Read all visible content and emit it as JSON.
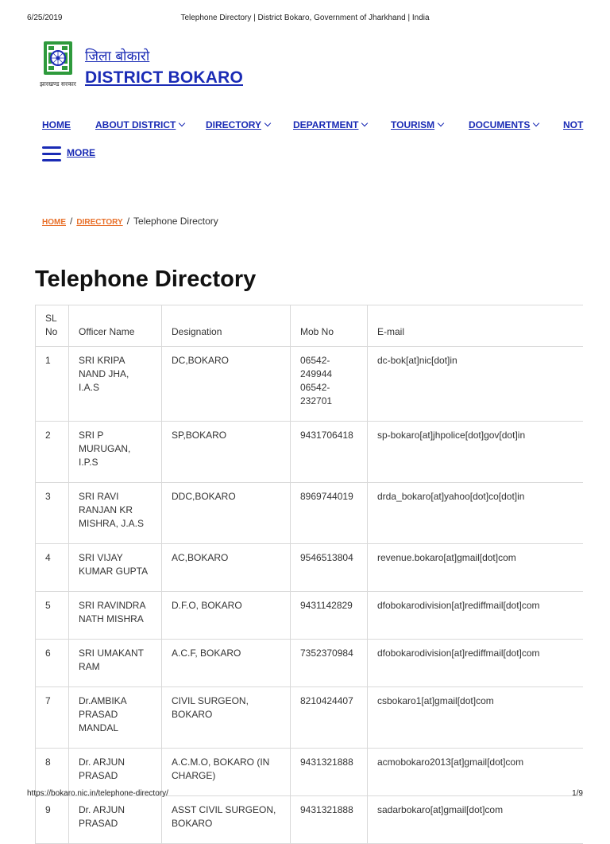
{
  "print_header": {
    "date": "6/25/2019",
    "title": "Telephone Directory | District Bokaro, Government of Jharkhand | India"
  },
  "print_footer": {
    "url": "https://bokaro.nic.in/telephone-directory/",
    "page": "1/9"
  },
  "site": {
    "hindi_name": "जिला बोकारो",
    "name": "DISTRICT BOKARO",
    "emblem_text": "झारखण्ड सरकार",
    "brand_color": "#1a2bb5",
    "emblem_color": "#2e9a3c"
  },
  "nav": {
    "items": [
      {
        "label": "HOME",
        "dropdown": false
      },
      {
        "label": "ABOUT DISTRICT",
        "dropdown": true
      },
      {
        "label": "DIRECTORY",
        "dropdown": true
      },
      {
        "label": "DEPARTMENT",
        "dropdown": true
      },
      {
        "label": "TOURISM",
        "dropdown": true
      },
      {
        "label": "DOCUMENTS",
        "dropdown": true
      },
      {
        "label": "NOT",
        "dropdown": false
      }
    ],
    "more_label": "MORE"
  },
  "breadcrumb": {
    "home": "HOME",
    "directory": "DIRECTORY",
    "current": "Telephone Directory",
    "link_color": "#e8702a"
  },
  "page_title": "Telephone Directory",
  "table": {
    "headers": {
      "sl": "SL No",
      "name": "Officer Name",
      "designation": "Designation",
      "mob": "Mob No",
      "email": "E-mail"
    },
    "rows": [
      {
        "sl": "1",
        "name": "SRI KRIPA NAND JHA, I.A.S",
        "designation": "DC,BOKARO",
        "mob": "06542-249944 06542-232701",
        "email": "dc-bok[at]nic[dot]in"
      },
      {
        "sl": "2",
        "name": "SRI P MURUGAN, I.P.S",
        "designation": "SP,BOKARO",
        "mob": "9431706418",
        "email": "sp-bokaro[at]jhpolice[dot]gov[dot]in"
      },
      {
        "sl": "3",
        "name": "SRI RAVI RANJAN KR MISHRA, J.A.S",
        "designation": "DDC,BOKARO",
        "mob": "8969744019",
        "email": "drda_bokaro[at]yahoo[dot]co[dot]in"
      },
      {
        "sl": "4",
        "name": "SRI VIJAY KUMAR GUPTA",
        "designation": "AC,BOKARO",
        "mob": "9546513804",
        "email": "revenue.bokaro[at]gmail[dot]com"
      },
      {
        "sl": "5",
        "name": "SRI RAVINDRA NATH MISHRA",
        "designation": "D.F.O, BOKARO",
        "mob": "9431142829",
        "email": "dfobokarodivision[at]rediffmail[dot]com"
      },
      {
        "sl": "6",
        "name": "SRI UMAKANT RAM",
        "designation": "A.C.F, BOKARO",
        "mob": "7352370984",
        "email": "dfobokarodivision[at]rediffmail[dot]com"
      },
      {
        "sl": "7",
        "name": "Dr.AMBIKA PRASAD MANDAL",
        "designation": "CIVIL SURGEON, BOKARO",
        "mob": "8210424407",
        "email": "csbokaro1[at]gmail[dot]com"
      },
      {
        "sl": "8",
        "name": "Dr. ARJUN PRASAD",
        "designation": "A.C.M.O, BOKARO (IN CHARGE)",
        "mob": "9431321888",
        "email": "acmobokaro2013[at]gmail[dot]com"
      },
      {
        "sl": "9",
        "name": "Dr. ARJUN PRASAD",
        "designation": "ASST CIVIL SURGEON, BOKARO",
        "mob": "9431321888",
        "email": "sadarbokaro[at]gmail[dot]com"
      }
    ]
  }
}
